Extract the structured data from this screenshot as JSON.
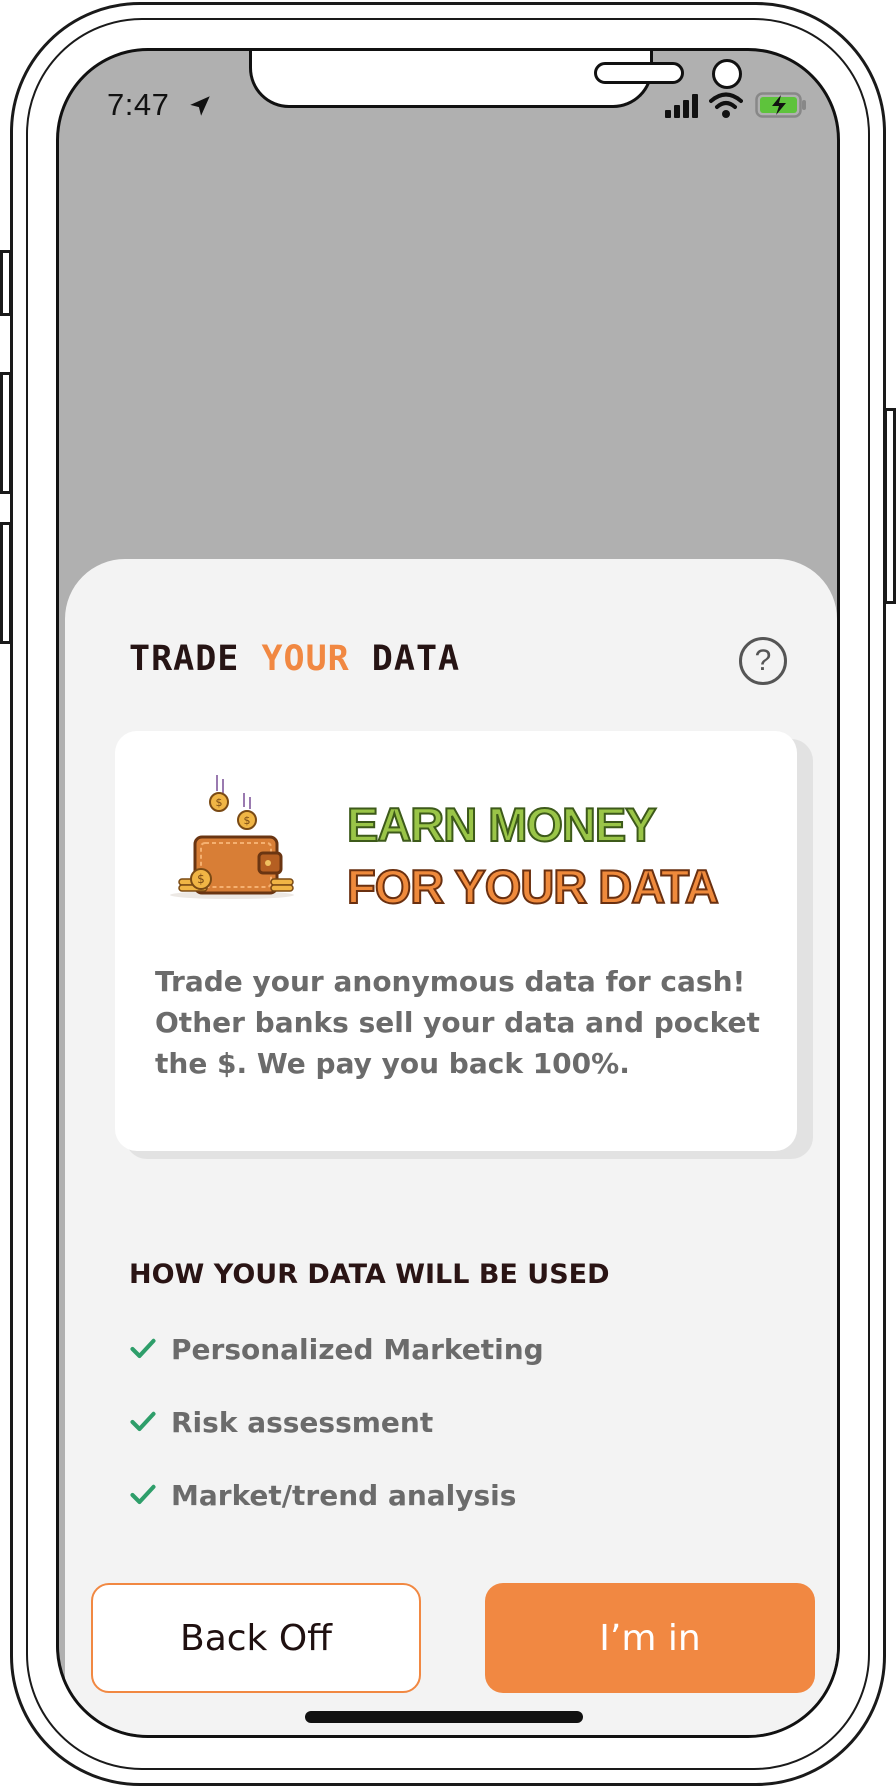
{
  "status_bar": {
    "time": "7:47",
    "icons": [
      "location-arrow-icon",
      "signal-icon",
      "wifi-icon",
      "battery-charging-icon"
    ]
  },
  "sheet": {
    "title_part1": "TRADE ",
    "title_accent": "YOUR",
    "title_part2": " DATA",
    "help_label": "?"
  },
  "card": {
    "headline_line1": "EARN MONEY",
    "headline_line2": "FOR YOUR DATA",
    "description": "Trade your anonymous data for cash! Other banks sell your data and pocket the $. We pay you back 100%."
  },
  "usage": {
    "heading": "HOW YOUR DATA WILL BE USED",
    "items": [
      {
        "label": "Personalized Marketing"
      },
      {
        "label": "Risk assessment"
      },
      {
        "label": "Market/trend analysis"
      }
    ]
  },
  "actions": {
    "back_label": "Back Off",
    "accept_label": "I’m in"
  },
  "colors": {
    "accent": "#f18842",
    "green_headline": "#9ac548",
    "check": "#2e9e6a",
    "backdrop": "#b0b0b0",
    "sheet_bg": "#f3f3f3"
  }
}
